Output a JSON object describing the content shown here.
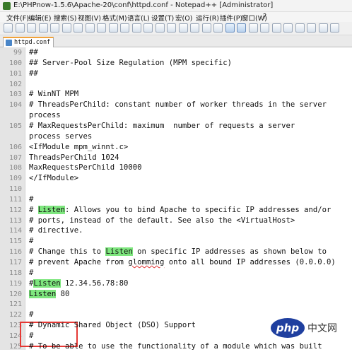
{
  "window": {
    "title": "E:\\PHPnow-1.5.6\\Apache-20\\conf\\httpd.conf - Notepad++ [Administrator]"
  },
  "menu": [
    "文件(F)",
    "编辑(E)",
    "搜索(S)",
    "视图(V)",
    "格式(M)",
    "语言(L)",
    "设置(T)",
    "宏(O)",
    "运行(R)",
    "插件(P)",
    "窗口(W)",
    "?"
  ],
  "toolbar_icons": [
    "new-file-icon",
    "open-icon",
    "save-icon",
    "save-all-icon",
    "close-icon",
    "close-all-icon",
    "print-icon",
    "cut-icon",
    "copy-icon",
    "paste-icon",
    "undo-icon",
    "redo-icon",
    "find-icon",
    "replace-icon",
    "zoom-in-icon",
    "zoom-out-icon",
    "sync-v-icon",
    "sync-h-icon",
    "word-wrap-icon",
    "show-all-icon",
    "indent-guide-icon",
    "doc-map-icon",
    "function-list-icon",
    "record-macro-icon",
    "stop-macro-icon",
    "play-macro-icon",
    "run-macro-icon",
    "save-macro-icon",
    "abc-icon"
  ],
  "tab": {
    "label": "httpd.conf"
  },
  "lines": [
    {
      "n": "99",
      "segs": [
        {
          "t": "##"
        }
      ]
    },
    {
      "n": "100",
      "segs": [
        {
          "t": "## Server-Pool Size Regulation (MPM specific)"
        }
      ]
    },
    {
      "n": "101",
      "segs": [
        {
          "t": "##"
        }
      ]
    },
    {
      "n": "102",
      "segs": []
    },
    {
      "n": "103",
      "segs": [
        {
          "t": "# WinNT MPM"
        }
      ]
    },
    {
      "n": "104",
      "segs": [
        {
          "t": "# ThreadsPerChild: constant number of worker threads in the server"
        }
      ]
    },
    {
      "n": "",
      "segs": [
        {
          "t": "process"
        }
      ]
    },
    {
      "n": "105",
      "segs": [
        {
          "t": "# MaxRequestsPerChild: maximum  number of requests a server"
        }
      ]
    },
    {
      "n": "",
      "segs": [
        {
          "t": "process serves"
        }
      ]
    },
    {
      "n": "106",
      "segs": [
        {
          "t": "<IfModule mpm_winnt.c>"
        }
      ]
    },
    {
      "n": "107",
      "segs": [
        {
          "t": "ThreadsPerChild 1024"
        }
      ]
    },
    {
      "n": "108",
      "segs": [
        {
          "t": "MaxRequestsPerChild 10000"
        }
      ]
    },
    {
      "n": "109",
      "segs": [
        {
          "t": "</IfModule>"
        }
      ]
    },
    {
      "n": "110",
      "segs": []
    },
    {
      "n": "111",
      "segs": [
        {
          "t": "#"
        }
      ]
    },
    {
      "n": "112",
      "segs": [
        {
          "t": "# "
        },
        {
          "t": "Listen",
          "hl": true
        },
        {
          "t": ": Allows you to bind Apache to specific IP addresses and/or"
        }
      ]
    },
    {
      "n": "113",
      "segs": [
        {
          "t": "# ports, instead of the default. See also the <VirtualHost>"
        }
      ]
    },
    {
      "n": "114",
      "segs": [
        {
          "t": "# directive."
        }
      ]
    },
    {
      "n": "115",
      "segs": [
        {
          "t": "#"
        }
      ]
    },
    {
      "n": "116",
      "segs": [
        {
          "t": "# Change this to "
        },
        {
          "t": "Listen",
          "hl": true
        },
        {
          "t": " on specific IP addresses as shown below to"
        }
      ]
    },
    {
      "n": "117",
      "segs": [
        {
          "t": "# prevent Apache from "
        },
        {
          "t": "glomming",
          "sq": true
        },
        {
          "t": " onto all bound IP addresses (0.0.0.0)"
        }
      ]
    },
    {
      "n": "118",
      "segs": [
        {
          "t": "#"
        }
      ]
    },
    {
      "n": "119",
      "segs": [
        {
          "t": "#"
        },
        {
          "t": "Listen",
          "hl": true
        },
        {
          "t": " 12.34.56.78:80"
        }
      ]
    },
    {
      "n": "120",
      "segs": [
        {
          "t": "Listen",
          "hl": true
        },
        {
          "t": " 80"
        }
      ]
    },
    {
      "n": "121",
      "segs": []
    },
    {
      "n": "122",
      "segs": [
        {
          "t": "#"
        }
      ]
    },
    {
      "n": "123",
      "segs": [
        {
          "t": "# Dynamic Shared Object (DSO) Support"
        }
      ]
    },
    {
      "n": "124",
      "segs": [
        {
          "t": "#"
        }
      ]
    },
    {
      "n": "125",
      "segs": [
        {
          "t": "# To be able to use the functionality of a module which was built"
        }
      ]
    }
  ],
  "watermark": {
    "logo": "php",
    "text": "中文网"
  }
}
